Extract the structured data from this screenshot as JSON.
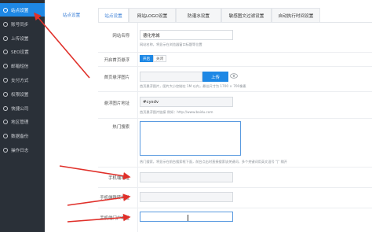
{
  "sidebar": {
    "items": [
      {
        "label": "站点设置",
        "active": true
      },
      {
        "label": "账号同步",
        "active": false
      },
      {
        "label": "上传设置",
        "active": false
      },
      {
        "label": "SEO设置",
        "active": false
      },
      {
        "label": "邮箱短信",
        "active": false
      },
      {
        "label": "支付方式",
        "active": false
      },
      {
        "label": "权限设置",
        "active": false
      },
      {
        "label": "快捷公司",
        "active": false
      },
      {
        "label": "地区管理",
        "active": false
      },
      {
        "label": "数据备份",
        "active": false
      },
      {
        "label": "操作日志",
        "active": false
      }
    ]
  },
  "tabs": {
    "header": "站点设置",
    "items": [
      "站点设置",
      "网站LOGO设置",
      "防灌水设置",
      "敏感图文过滤设置",
      "自动执行时间设置"
    ]
  },
  "form": {
    "site_name": {
      "label": "网站名称",
      "value": "德化常城",
      "help": "网站名称，将显示在浏览器窗口标题等位置"
    },
    "home_float": {
      "label": "开启首页悬浮",
      "on": "开启",
      "off": "关闭"
    },
    "float_image": {
      "label": "首页悬浮图片",
      "upload": "上传",
      "help": "首页悬浮图片，图片大小控制在 1M 以内，最佳尺寸为 1700 × 700像素"
    },
    "float_link": {
      "label": "悬浮图片地址",
      "value": "#cysdv",
      "help": "首页悬浮图片链接 例如：http://www.baidu.com"
    },
    "hot_search": {
      "label": "热门搜索",
      "help": "热门搜索，将显示在前台搜索框下面，前台点击时直接搜索该关键词，多个关键词用英文逗号 \"|\" 隔开"
    },
    "mobile_url": {
      "label": "手机端地址"
    },
    "mobile_redirect": {
      "label": "手机端跳转地址"
    },
    "mobile_entry": {
      "label": "手机端门户地址"
    }
  },
  "colors": {
    "sidebar_bg": "#2a3038",
    "accent": "#1e88e5",
    "arrow": "#e0302a"
  }
}
